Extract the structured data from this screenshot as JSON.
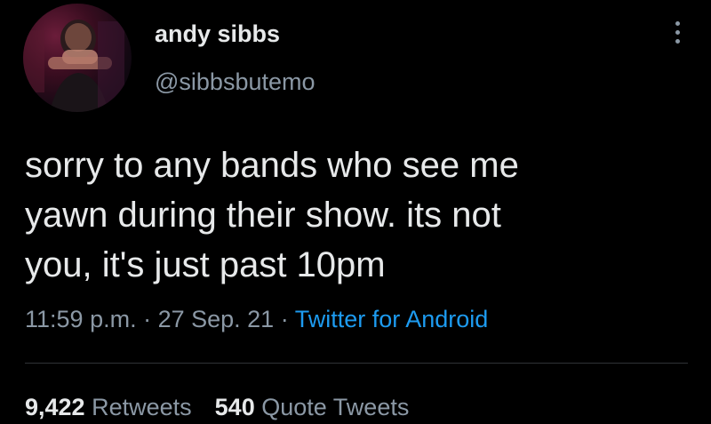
{
  "author": {
    "display_name": "andy sibbs",
    "handle": "@sibbsbutemo",
    "avatar_icon": "profile-photo"
  },
  "more_icon": "more-vertical-icon",
  "tweet": {
    "lines": [
      "sorry to any bands who see me",
      "yawn during their show. its not",
      "you, it's just past 10pm"
    ]
  },
  "meta": {
    "time": "11:59 p.m.",
    "sep1": " · ",
    "date": "27 Sep. 21",
    "sep2": " · ",
    "source": "Twitter for Android"
  },
  "stats": {
    "retweets_count": "9,422",
    "retweets_label": "Retweets",
    "quotes_count": "540",
    "quotes_label": "Quote Tweets"
  },
  "colors": {
    "background": "#000000",
    "text": "#e7e9ea",
    "secondary": "#8b98a5",
    "link": "#1d9bf0",
    "divider": "#2f3336"
  }
}
